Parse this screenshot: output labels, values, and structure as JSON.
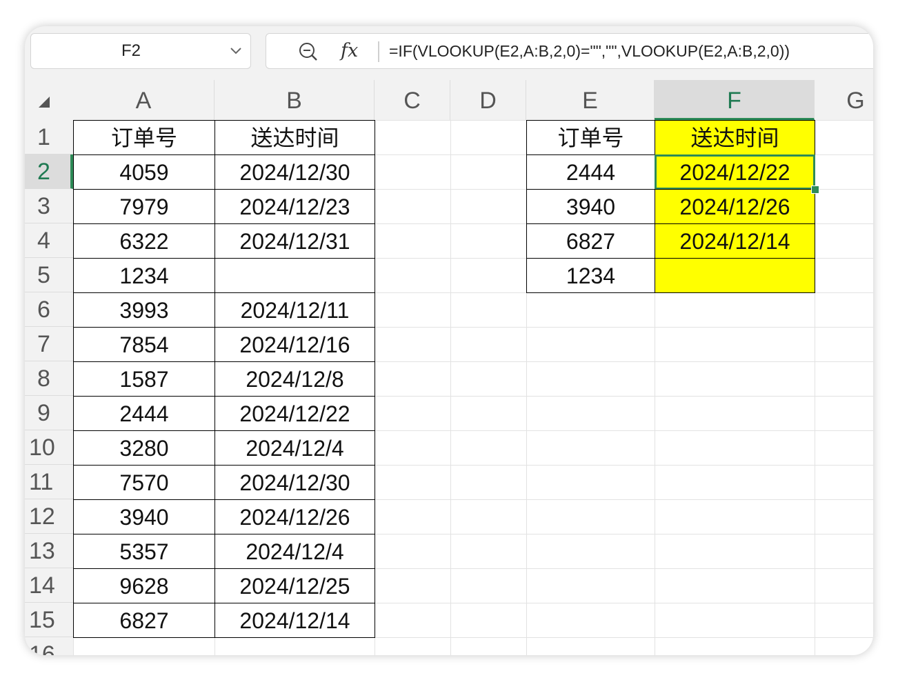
{
  "name_box": {
    "ref": "F2"
  },
  "formula_bar": {
    "fx_label": "fx",
    "formula": "=IF(VLOOKUP(E2,A:B,2,0)=\"\",\"\",VLOOKUP(E2,A:B,2,0))"
  },
  "columns": [
    "A",
    "B",
    "C",
    "D",
    "E",
    "F",
    "G"
  ],
  "selected_column": "F",
  "rows": [
    "1",
    "2",
    "3",
    "4",
    "5",
    "6",
    "7",
    "8",
    "9",
    "10",
    "11",
    "12",
    "13",
    "14",
    "15",
    "16"
  ],
  "selected_row": "2",
  "source_table": {
    "headers": [
      "订单号",
      "送达时间"
    ],
    "rows": [
      [
        "4059",
        "2024/12/30"
      ],
      [
        "7979",
        "2024/12/23"
      ],
      [
        "6322",
        "2024/12/31"
      ],
      [
        "1234",
        ""
      ],
      [
        "3993",
        "2024/12/11"
      ],
      [
        "7854",
        "2024/12/16"
      ],
      [
        "1587",
        "2024/12/8"
      ],
      [
        "2444",
        "2024/12/22"
      ],
      [
        "3280",
        "2024/12/4"
      ],
      [
        "7570",
        "2024/12/30"
      ],
      [
        "3940",
        "2024/12/26"
      ],
      [
        "5357",
        "2024/12/4"
      ],
      [
        "9628",
        "2024/12/25"
      ],
      [
        "6827",
        "2024/12/14"
      ]
    ]
  },
  "lookup_table": {
    "headers": [
      "订单号",
      "送达时间"
    ],
    "rows": [
      [
        "2444",
        "2024/12/22"
      ],
      [
        "3940",
        "2024/12/26"
      ],
      [
        "6827",
        "2024/12/14"
      ],
      [
        "1234",
        ""
      ]
    ]
  },
  "colors": {
    "highlight": "#ffff00",
    "selection": "#2e8b57"
  }
}
